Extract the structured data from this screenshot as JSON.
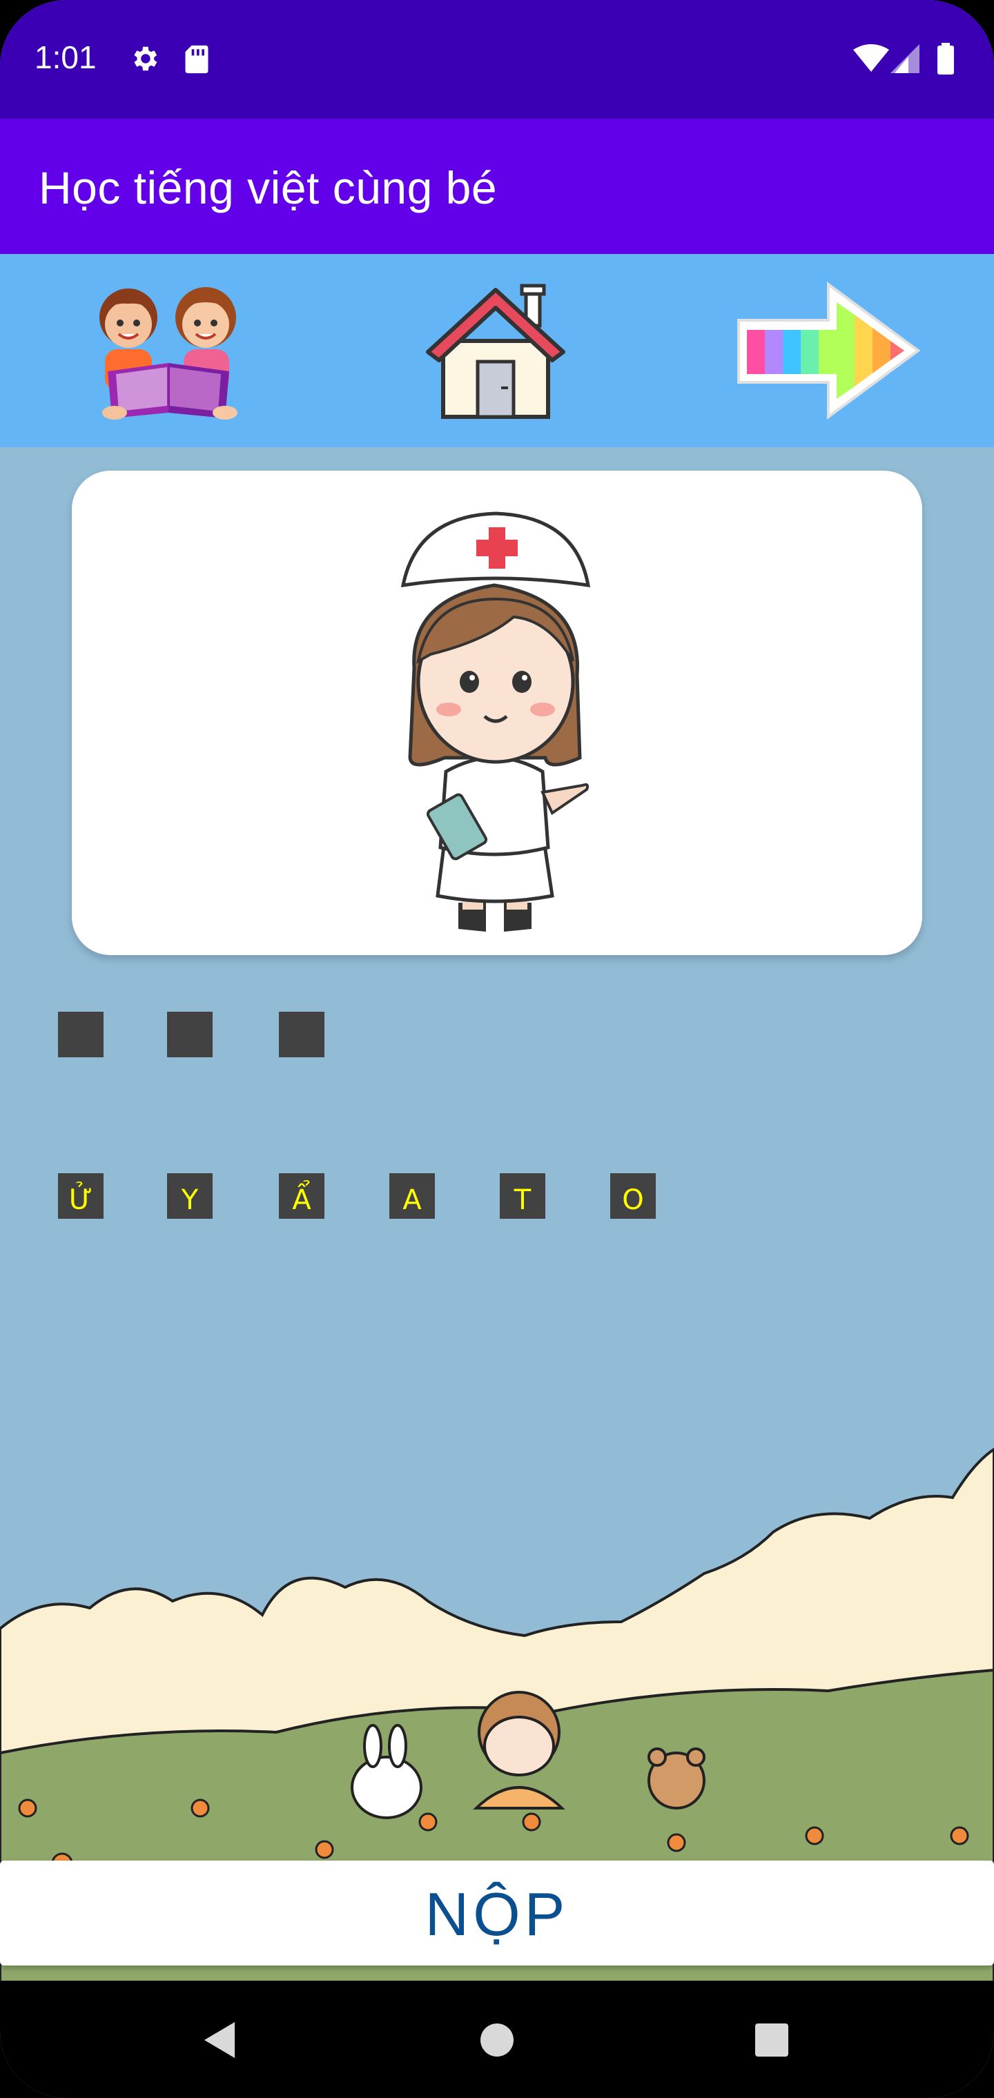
{
  "status_bar": {
    "time": "1:01",
    "icons": [
      "gear-icon",
      "sd-card-icon",
      "wifi-icon",
      "signal-icon",
      "battery-icon"
    ]
  },
  "app_bar": {
    "title": "Học tiếng việt cùng bé",
    "color": "#6200ea"
  },
  "toolbar": {
    "color": "#64b5f6",
    "buttons": [
      "kids-reading-icon",
      "home-icon",
      "rainbow-arrow-icon"
    ]
  },
  "quiz": {
    "picture": "nurse-illustration",
    "answer_slots": 3,
    "letters": [
      "Ử",
      "Y",
      "Ẩ",
      "A",
      "T",
      "O"
    ],
    "letter_color": "#ffff00"
  },
  "submit": {
    "label": "NỘP"
  },
  "nav_bar": {
    "buttons": [
      "back-icon",
      "home-circle-icon",
      "recents-icon"
    ]
  }
}
